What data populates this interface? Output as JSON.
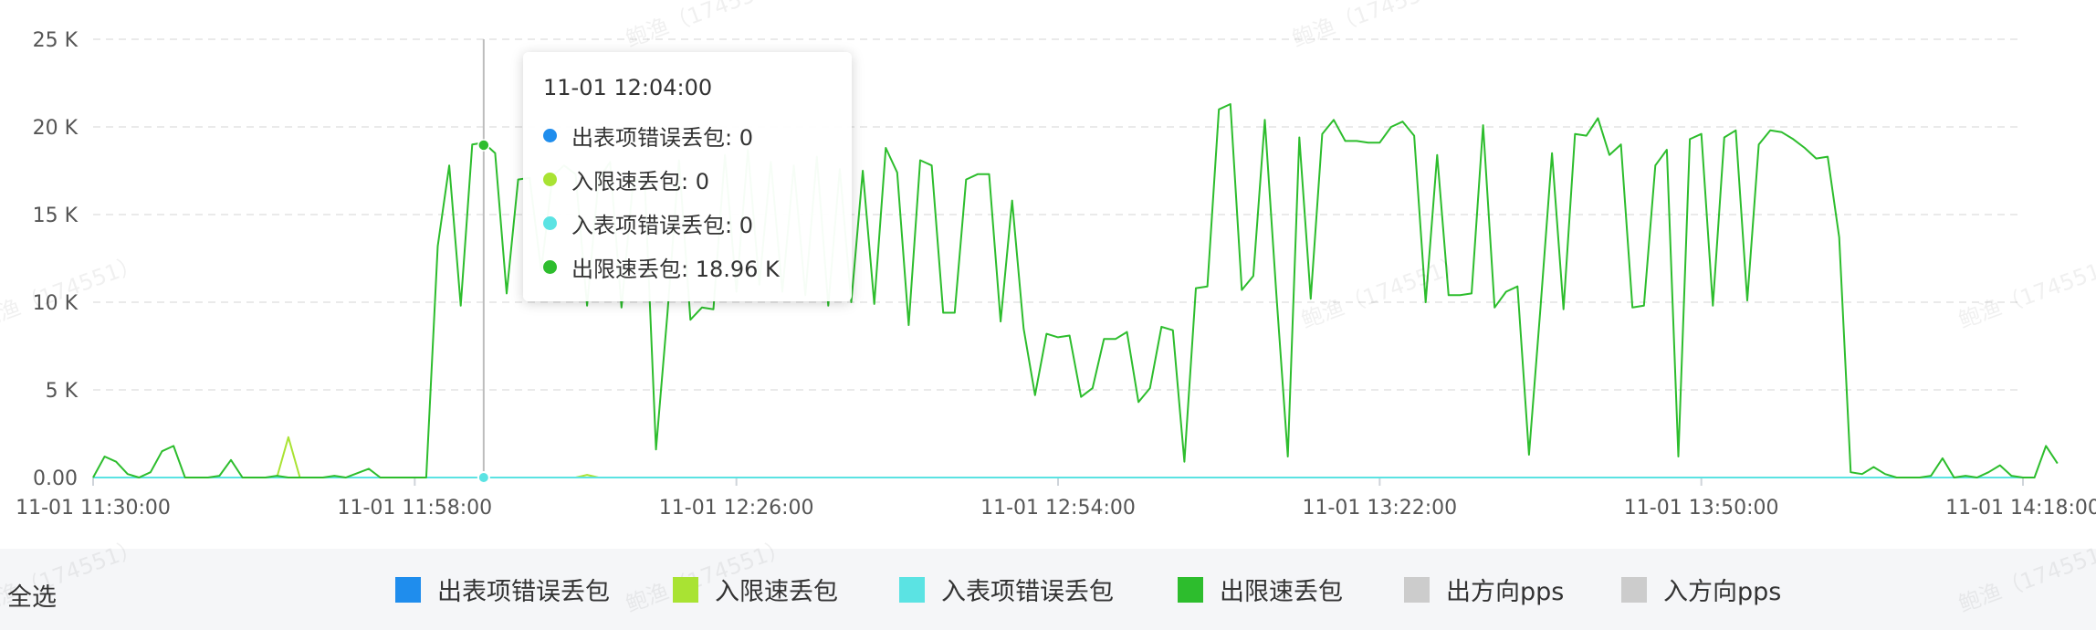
{
  "chart_data": {
    "type": "line",
    "y_ticks": [
      "25 K",
      "20 K",
      "15 K",
      "10 K",
      "5 K",
      "0.00"
    ],
    "y_tick_values": [
      25000,
      20000,
      15000,
      10000,
      5000,
      0
    ],
    "ylim": [
      0,
      25000
    ],
    "x_ticks": [
      "11-01 11:30:00",
      "11-01 11:58:00",
      "11-01 12:26:00",
      "11-01 12:54:00",
      "11-01 13:22:00",
      "11-01 13:50:00",
      "11-01 14:18:00"
    ],
    "x_start_minutes": 0,
    "x_end_minutes": 168,
    "grid": true,
    "legend_position": "bottom",
    "series": [
      {
        "name": "出表项错误丢包",
        "color": "#1f8ded",
        "values_constant": 0
      },
      {
        "name": "入限速丢包",
        "color": "#a9e333",
        "points": [
          [
            0,
            0
          ],
          [
            16,
            0
          ],
          [
            17,
            2300
          ],
          [
            18,
            0
          ],
          [
            42,
            0
          ],
          [
            43,
            150
          ],
          [
            44,
            0
          ],
          [
            168,
            0
          ]
        ]
      },
      {
        "name": "入表项错误丢包",
        "color": "#5be3e3",
        "values_constant": 0
      },
      {
        "name": "出限速丢包",
        "color": "#2dbd2d",
        "points": [
          [
            0,
            0
          ],
          [
            1,
            1200
          ],
          [
            2,
            900
          ],
          [
            3,
            200
          ],
          [
            4,
            0
          ],
          [
            5,
            300
          ],
          [
            6,
            1500
          ],
          [
            7,
            1800
          ],
          [
            8,
            0
          ],
          [
            10,
            0
          ],
          [
            11,
            100
          ],
          [
            12,
            1000
          ],
          [
            13,
            0
          ],
          [
            15,
            0
          ],
          [
            16,
            100
          ],
          [
            17,
            0
          ],
          [
            20,
            0
          ],
          [
            21,
            100
          ],
          [
            22,
            0
          ],
          [
            24,
            500
          ],
          [
            25,
            0
          ],
          [
            29,
            0
          ],
          [
            30,
            13200
          ],
          [
            31,
            17800
          ],
          [
            32,
            9800
          ],
          [
            33,
            19000
          ],
          [
            34,
            19100
          ],
          [
            35,
            18500
          ],
          [
            36,
            10500
          ],
          [
            37,
            17000
          ],
          [
            38,
            17100
          ],
          [
            39,
            11800
          ],
          [
            40,
            17200
          ],
          [
            41,
            17800
          ],
          [
            42,
            17300
          ],
          [
            43,
            9800
          ],
          [
            44,
            17000
          ],
          [
            45,
            18000
          ],
          [
            46,
            9700
          ],
          [
            47,
            16800
          ],
          [
            48,
            17200
          ],
          [
            49,
            1600
          ],
          [
            50,
            9400
          ],
          [
            51,
            18100
          ],
          [
            52,
            9000
          ],
          [
            53,
            9700
          ],
          [
            54,
            9600
          ],
          [
            55,
            18400
          ],
          [
            56,
            10600
          ],
          [
            57,
            18700
          ],
          [
            58,
            11000
          ],
          [
            59,
            18000
          ],
          [
            60,
            10600
          ],
          [
            61,
            17800
          ],
          [
            62,
            10400
          ],
          [
            63,
            18300
          ],
          [
            64,
            9800
          ],
          [
            65,
            17600
          ],
          [
            66,
            10000
          ],
          [
            67,
            17500
          ],
          [
            68,
            9900
          ],
          [
            69,
            18800
          ],
          [
            70,
            17400
          ],
          [
            71,
            8700
          ],
          [
            72,
            18100
          ],
          [
            73,
            17800
          ],
          [
            74,
            9400
          ],
          [
            75,
            9400
          ],
          [
            76,
            17000
          ],
          [
            77,
            17300
          ],
          [
            78,
            17300
          ],
          [
            79,
            8900
          ],
          [
            80,
            15800
          ],
          [
            81,
            8500
          ],
          [
            82,
            4700
          ],
          [
            83,
            8200
          ],
          [
            84,
            8000
          ],
          [
            85,
            8100
          ],
          [
            86,
            4600
          ],
          [
            87,
            5100
          ],
          [
            88,
            7900
          ],
          [
            89,
            7900
          ],
          [
            90,
            8300
          ],
          [
            91,
            4300
          ],
          [
            92,
            5100
          ],
          [
            93,
            8600
          ],
          [
            94,
            8400
          ],
          [
            95,
            900
          ],
          [
            96,
            10800
          ],
          [
            97,
            10900
          ],
          [
            98,
            21000
          ],
          [
            99,
            21300
          ],
          [
            100,
            10700
          ],
          [
            101,
            11500
          ],
          [
            102,
            20400
          ],
          [
            103,
            10500
          ],
          [
            104,
            1200
          ],
          [
            105,
            19400
          ],
          [
            106,
            10200
          ],
          [
            107,
            19600
          ],
          [
            108,
            20400
          ],
          [
            109,
            19200
          ],
          [
            110,
            19200
          ],
          [
            111,
            19100
          ],
          [
            112,
            19100
          ],
          [
            113,
            20000
          ],
          [
            114,
            20300
          ],
          [
            115,
            19500
          ],
          [
            116,
            10000
          ],
          [
            117,
            18400
          ],
          [
            118,
            10400
          ],
          [
            119,
            10400
          ],
          [
            120,
            10500
          ],
          [
            121,
            20100
          ],
          [
            122,
            9700
          ],
          [
            123,
            10600
          ],
          [
            124,
            10900
          ],
          [
            125,
            1300
          ],
          [
            126,
            9700
          ],
          [
            127,
            18500
          ],
          [
            128,
            9600
          ],
          [
            129,
            19600
          ],
          [
            130,
            19500
          ],
          [
            131,
            20500
          ],
          [
            132,
            18400
          ],
          [
            133,
            19000
          ],
          [
            134,
            9700
          ],
          [
            135,
            9800
          ],
          [
            136,
            17800
          ],
          [
            137,
            18700
          ],
          [
            138,
            1200
          ],
          [
            139,
            19300
          ],
          [
            140,
            19600
          ],
          [
            141,
            9800
          ],
          [
            142,
            19400
          ],
          [
            143,
            19800
          ],
          [
            144,
            10100
          ],
          [
            145,
            19000
          ],
          [
            146,
            19800
          ],
          [
            147,
            19700
          ],
          [
            148,
            19300
          ],
          [
            149,
            18800
          ],
          [
            150,
            18200
          ],
          [
            151,
            18300
          ],
          [
            152,
            13700
          ],
          [
            153,
            300
          ],
          [
            154,
            200
          ],
          [
            155,
            600
          ],
          [
            156,
            200
          ],
          [
            157,
            0
          ],
          [
            158,
            0
          ],
          [
            159,
            0
          ],
          [
            160,
            100
          ],
          [
            161,
            1100
          ],
          [
            162,
            0
          ],
          [
            163,
            100
          ],
          [
            164,
            0
          ],
          [
            165,
            300
          ],
          [
            166,
            700
          ],
          [
            167,
            100
          ],
          [
            168,
            0
          ],
          [
            169,
            0
          ],
          [
            170,
            1800
          ],
          [
            171,
            800
          ]
        ]
      },
      {
        "name": "出方向pps",
        "color": "#cccccc",
        "hidden": true
      },
      {
        "name": "入方向pps",
        "color": "#cccccc",
        "hidden": true
      }
    ],
    "hover_x_minutes": 34,
    "hover_value": 18960
  },
  "tooltip": {
    "time": "11-01 12:04:00",
    "rows": [
      {
        "label": "出表项错误丢包: 0",
        "color": "#1f8ded"
      },
      {
        "label": "入限速丢包: 0",
        "color": "#a9e333"
      },
      {
        "label": "入表项错误丢包: 0",
        "color": "#5be3e3"
      },
      {
        "label": "出限速丢包: 18.96 K",
        "color": "#2dbd2d"
      }
    ]
  },
  "legend": {
    "select_all": "全选",
    "items": [
      {
        "label": "出表项错误丢包",
        "color": "#1f8ded"
      },
      {
        "label": "入限速丢包",
        "color": "#a9e333"
      },
      {
        "label": "入表项错误丢包",
        "color": "#5be3e3"
      },
      {
        "label": "出限速丢包",
        "color": "#2dbd2d"
      },
      {
        "label": "出方向pps",
        "color": "#cccccc"
      },
      {
        "label": "入方向pps",
        "color": "#cccccc"
      }
    ]
  },
  "watermark": "鲍渔（174551）"
}
